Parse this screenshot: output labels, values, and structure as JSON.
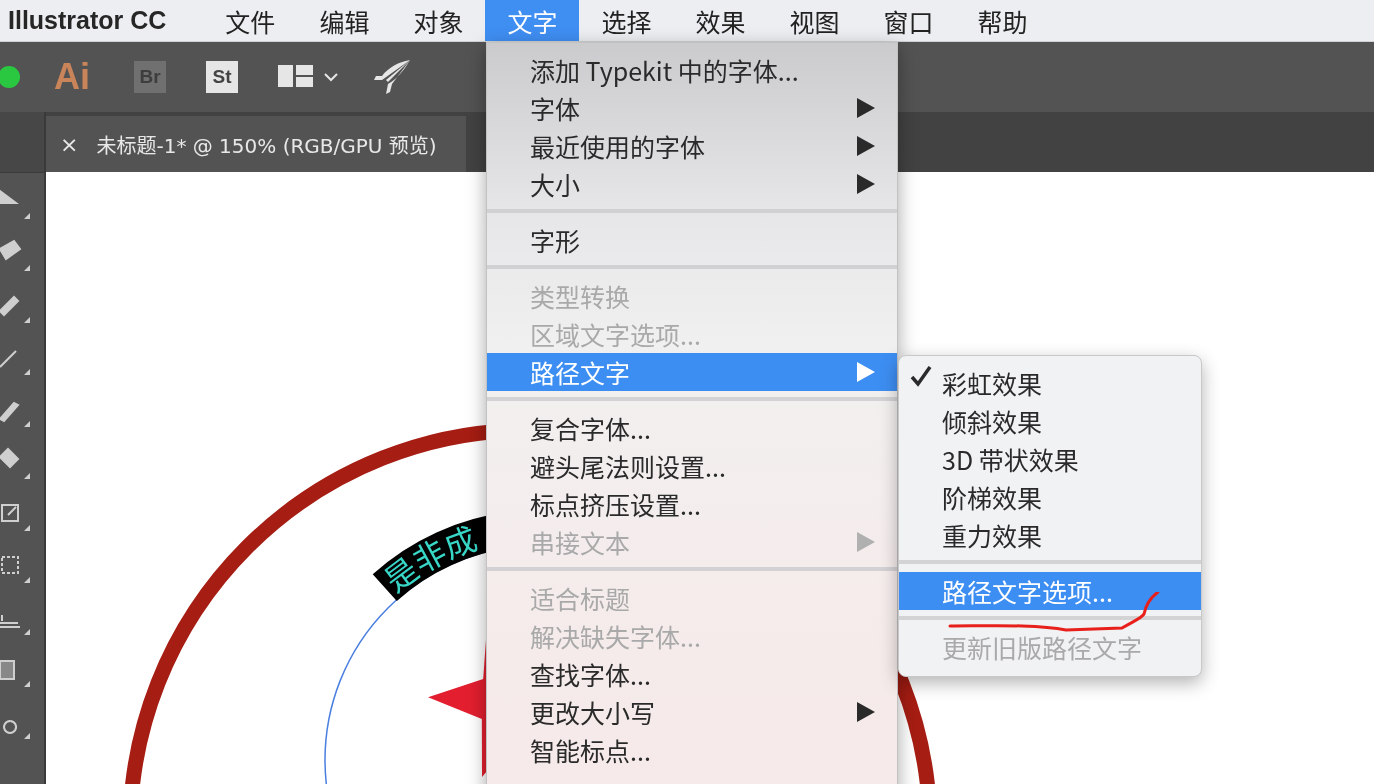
{
  "menu_bar": {
    "app_name": "Illustrator CC",
    "items": [
      {
        "label": "文件",
        "selected": false
      },
      {
        "label": "编辑",
        "selected": false
      },
      {
        "label": "对象",
        "selected": false
      },
      {
        "label": "文字",
        "selected": true
      },
      {
        "label": "选择",
        "selected": false
      },
      {
        "label": "效果",
        "selected": false
      },
      {
        "label": "视图",
        "selected": false
      },
      {
        "label": "窗口",
        "selected": false
      },
      {
        "label": "帮助",
        "selected": false
      }
    ]
  },
  "toolbar": {
    "app_logo": "Ai",
    "bridge": "Br",
    "stock": "St"
  },
  "document_tab": {
    "close": "×",
    "title": "未标题-1* @ 150% (RGB/GPU 预览)"
  },
  "artwork": {
    "path_text": "是非成"
  },
  "type_menu": [
    {
      "kind": "item",
      "label": "添加 Typekit 中的字体...",
      "disabled": false,
      "submenu": false,
      "selected": false
    },
    {
      "kind": "item",
      "label": "字体",
      "disabled": false,
      "submenu": true,
      "selected": false
    },
    {
      "kind": "item",
      "label": "最近使用的字体",
      "disabled": false,
      "submenu": true,
      "selected": false
    },
    {
      "kind": "item",
      "label": "大小",
      "disabled": false,
      "submenu": true,
      "selected": false
    },
    {
      "kind": "separator"
    },
    {
      "kind": "item",
      "label": "字形",
      "disabled": false,
      "submenu": false,
      "selected": false
    },
    {
      "kind": "separator"
    },
    {
      "kind": "item",
      "label": "类型转换",
      "disabled": true,
      "submenu": false,
      "selected": false
    },
    {
      "kind": "item",
      "label": "区域文字选项...",
      "disabled": true,
      "submenu": false,
      "selected": false
    },
    {
      "kind": "item",
      "label": "路径文字",
      "disabled": false,
      "submenu": true,
      "selected": true
    },
    {
      "kind": "separator"
    },
    {
      "kind": "item",
      "label": "复合字体...",
      "disabled": false,
      "submenu": false,
      "selected": false
    },
    {
      "kind": "item",
      "label": "避头尾法则设置...",
      "disabled": false,
      "submenu": false,
      "selected": false
    },
    {
      "kind": "item",
      "label": "标点挤压设置...",
      "disabled": false,
      "submenu": false,
      "selected": false
    },
    {
      "kind": "item",
      "label": "串接文本",
      "disabled": true,
      "submenu": true,
      "selected": false
    },
    {
      "kind": "separator"
    },
    {
      "kind": "item",
      "label": "适合标题",
      "disabled": true,
      "submenu": false,
      "selected": false
    },
    {
      "kind": "item",
      "label": "解决缺失字体...",
      "disabled": true,
      "submenu": false,
      "selected": false
    },
    {
      "kind": "item",
      "label": "查找字体...",
      "disabled": false,
      "submenu": false,
      "selected": false
    },
    {
      "kind": "item",
      "label": "更改大小写",
      "disabled": false,
      "submenu": true,
      "selected": false
    },
    {
      "kind": "item",
      "label": "智能标点...",
      "disabled": false,
      "submenu": false,
      "selected": false
    }
  ],
  "path_text_submenu": [
    {
      "kind": "item",
      "label": "彩虹效果",
      "checked": true,
      "disabled": false,
      "selected": false
    },
    {
      "kind": "item",
      "label": "倾斜效果",
      "checked": false,
      "disabled": false,
      "selected": false
    },
    {
      "kind": "item",
      "label": "3D 带状效果",
      "checked": false,
      "disabled": false,
      "selected": false
    },
    {
      "kind": "item",
      "label": "阶梯效果",
      "checked": false,
      "disabled": false,
      "selected": false
    },
    {
      "kind": "item",
      "label": "重力效果",
      "checked": false,
      "disabled": false,
      "selected": false
    },
    {
      "kind": "separator"
    },
    {
      "kind": "item",
      "label": "路径文字选项...",
      "checked": false,
      "disabled": false,
      "selected": true
    },
    {
      "kind": "separator"
    },
    {
      "kind": "item",
      "label": "更新旧版路径文字",
      "checked": false,
      "disabled": true,
      "selected": false
    }
  ]
}
